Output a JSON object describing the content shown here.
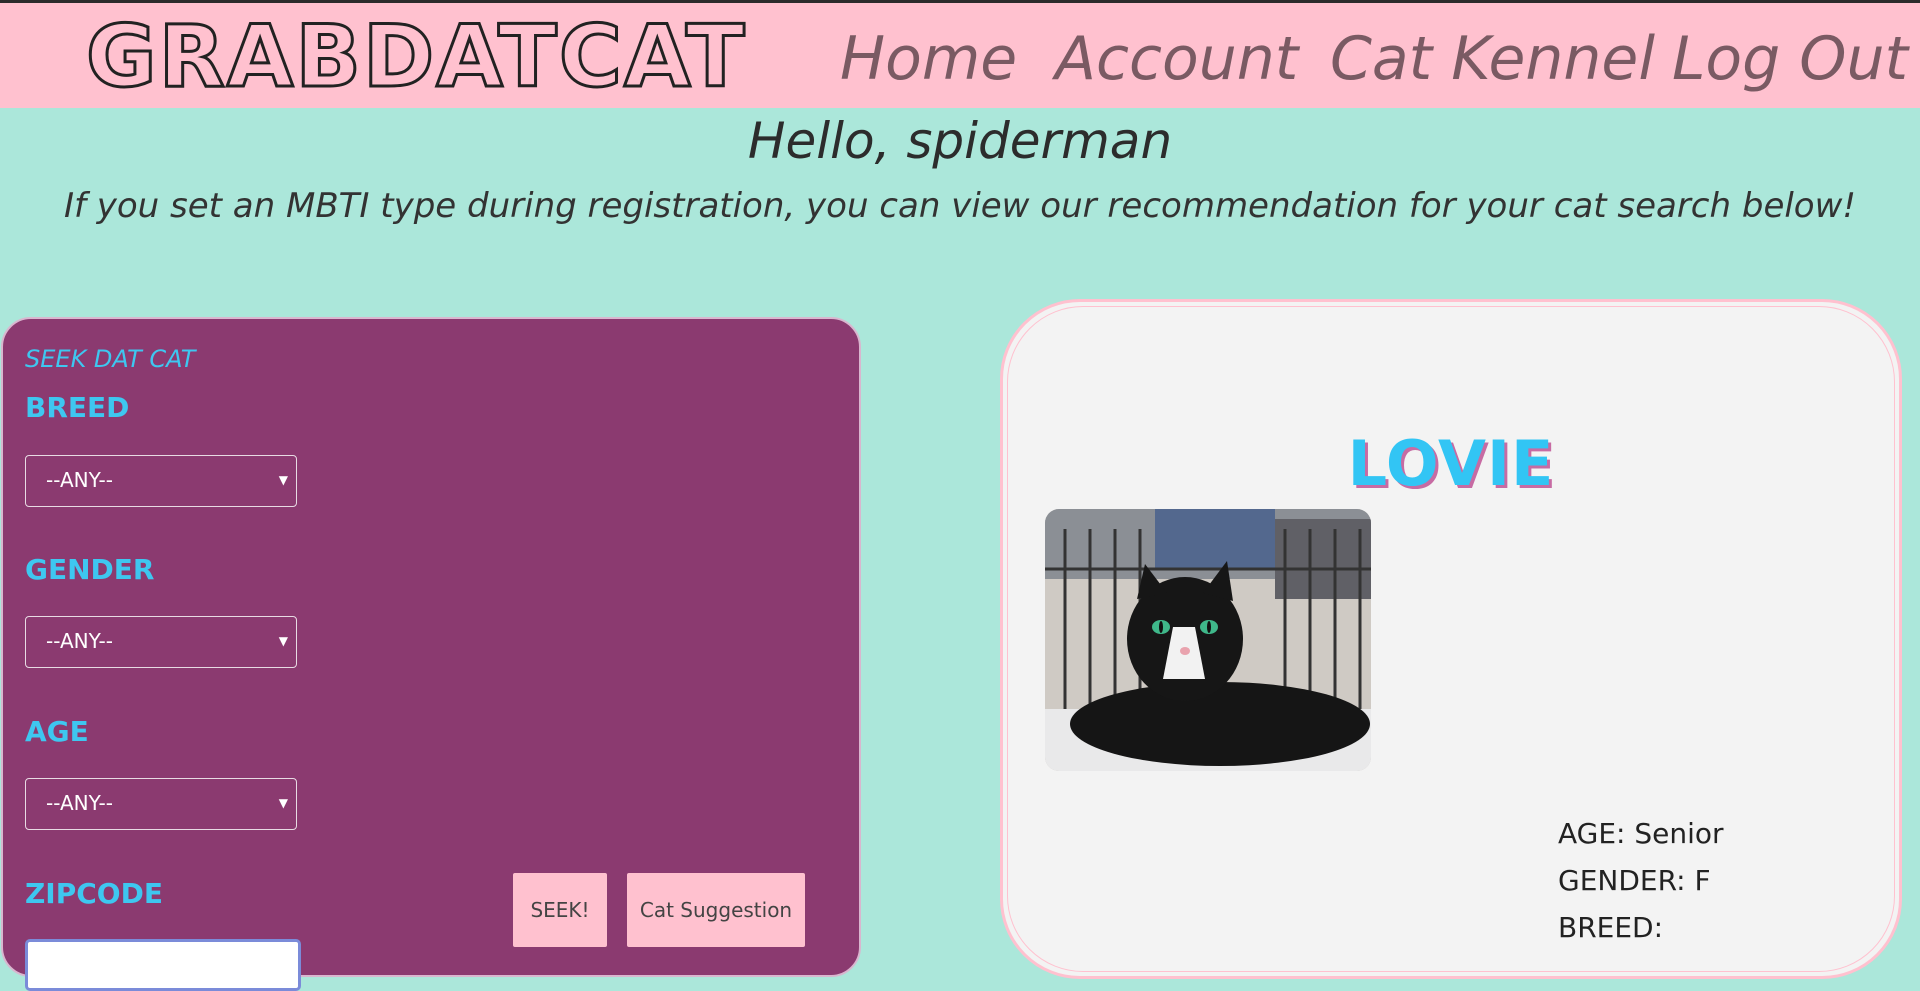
{
  "navbar": {
    "logo": "GRABDATCAT",
    "links": [
      "Home",
      "Account",
      "Cat Kennel",
      "Log Out"
    ]
  },
  "greeting": "Hello, spiderman",
  "subtitle": "If you set an MBTI type during registration, you can view our recommendation for your cat search below!",
  "search": {
    "heading": "SEEK DAT CAT",
    "breed_label": "BREED",
    "breed_value": "--ANY--",
    "gender_label": "GENDER",
    "gender_value": "--ANY--",
    "age_label": "AGE",
    "age_value": "--ANY--",
    "zip_label": "ZIPCODE",
    "zip_value": "",
    "seek_button": "SEEK!",
    "suggest_button": "Cat Suggestion"
  },
  "cat": {
    "name": "LOVIE",
    "age": "AGE: Senior",
    "gender": "GENDER: F",
    "breed": "BREED:"
  }
}
